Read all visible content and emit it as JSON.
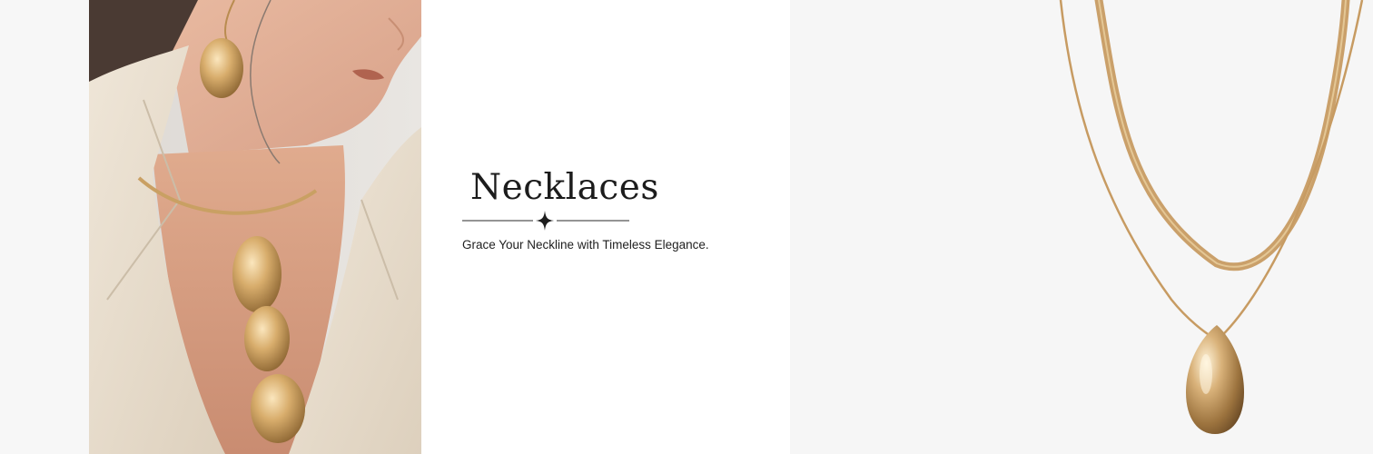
{
  "banner": {
    "title": "Necklaces",
    "subtitle": "Grace Your Neckline with Timeless Elegance.",
    "divider_icon": "four-point-star-icon",
    "colors": {
      "gold": "#c9a063",
      "text": "#1c1c1c",
      "background": "#ffffff",
      "photo_background": "#f6f6f6"
    }
  }
}
